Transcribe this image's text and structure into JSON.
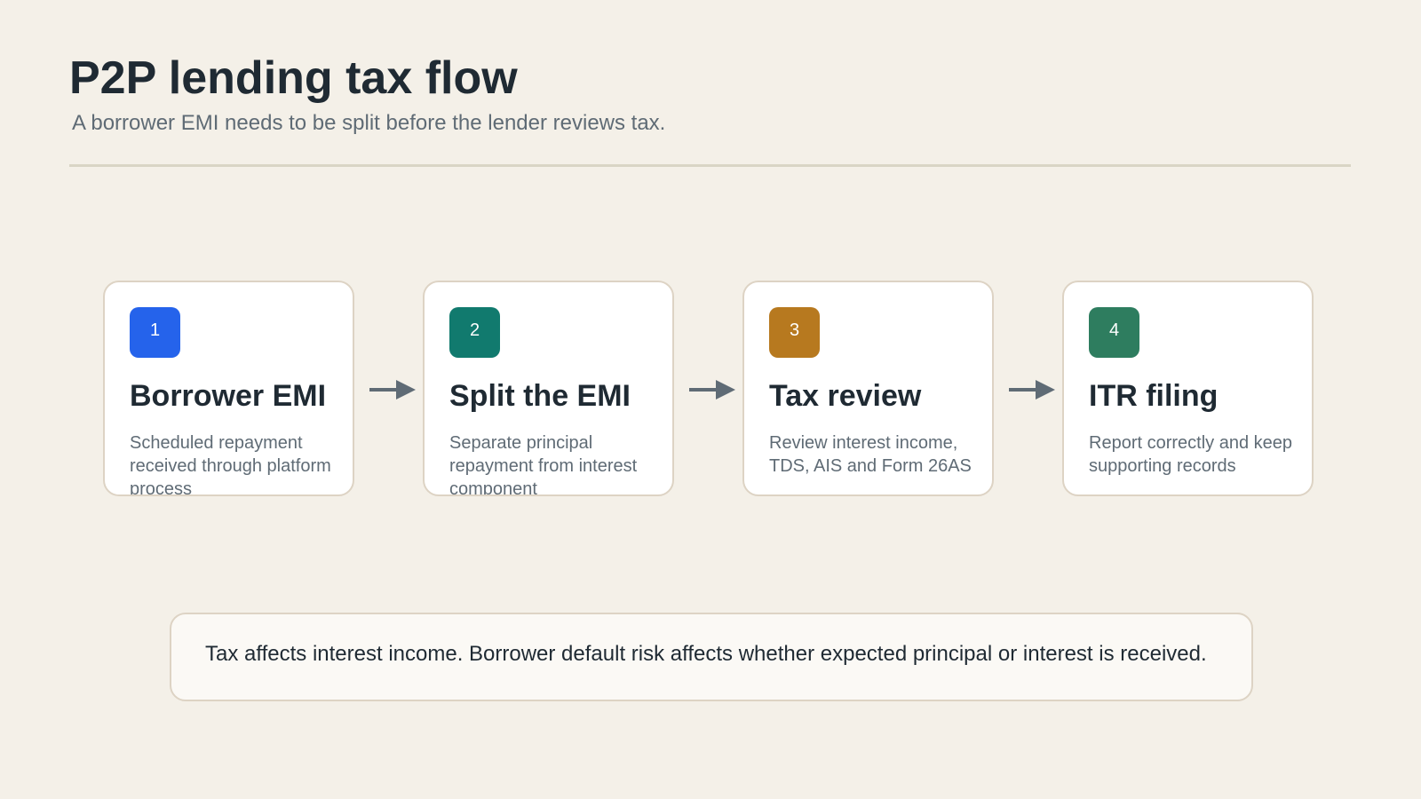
{
  "header": {
    "title": "P2P lending tax flow",
    "subtitle": "A borrower EMI needs to be split before the lender reviews tax."
  },
  "steps": [
    {
      "number": "1",
      "title": "Borrower EMI",
      "description": "Scheduled repayment received through platform process",
      "badge_color": "#2563eb"
    },
    {
      "number": "2",
      "title": "Split the EMI",
      "description": "Separate principal repayment from interest component",
      "badge_color": "#117a6e"
    },
    {
      "number": "3",
      "title": "Tax review",
      "description": "Review interest income, TDS, AIS and Form 26AS",
      "badge_color": "#b7791f"
    },
    {
      "number": "4",
      "title": "ITR filing",
      "description": "Report correctly and keep supporting records",
      "badge_color": "#2e7d5f"
    }
  ],
  "note": {
    "text": "Tax affects interest income. Borrower default risk affects whether expected principal or interest is received."
  },
  "colors": {
    "background": "#f4f0e8",
    "arrow": "#5f6b75",
    "card_border": "#ddd3c4"
  }
}
